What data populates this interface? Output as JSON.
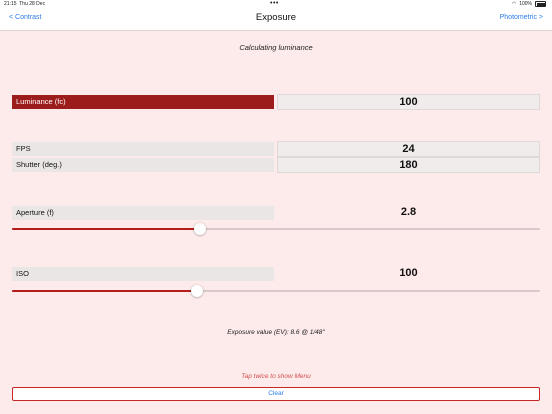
{
  "status_bar": {
    "time": "21:15",
    "date": "Thu 28 Dec",
    "battery": "100%"
  },
  "nav": {
    "back_label": "< Contrast",
    "title": "Exposure",
    "forward_label": "Photometric >"
  },
  "subtitle": "Calculating luminance",
  "luminance": {
    "label": "Luminance (fc)",
    "value": "100"
  },
  "fps": {
    "label": "FPS",
    "value": "24"
  },
  "shutter": {
    "label": "Shutter (deg.)",
    "value": "180"
  },
  "aperture": {
    "label": "Aperture (f)",
    "value": "2.8",
    "slider_fraction": 0.357
  },
  "iso": {
    "label": "ISO",
    "value": "100",
    "slider_fraction": 0.35
  },
  "ev_text": "Exposure value (EV): 8.6 @ 1/48\"",
  "menu_hint": "Tap twice to show Menu",
  "clear_label": "Clear",
  "colors": {
    "accent": "#9c1b1b",
    "link": "#2b7de9",
    "background": "#fdeaea",
    "hint": "#d0504e"
  }
}
